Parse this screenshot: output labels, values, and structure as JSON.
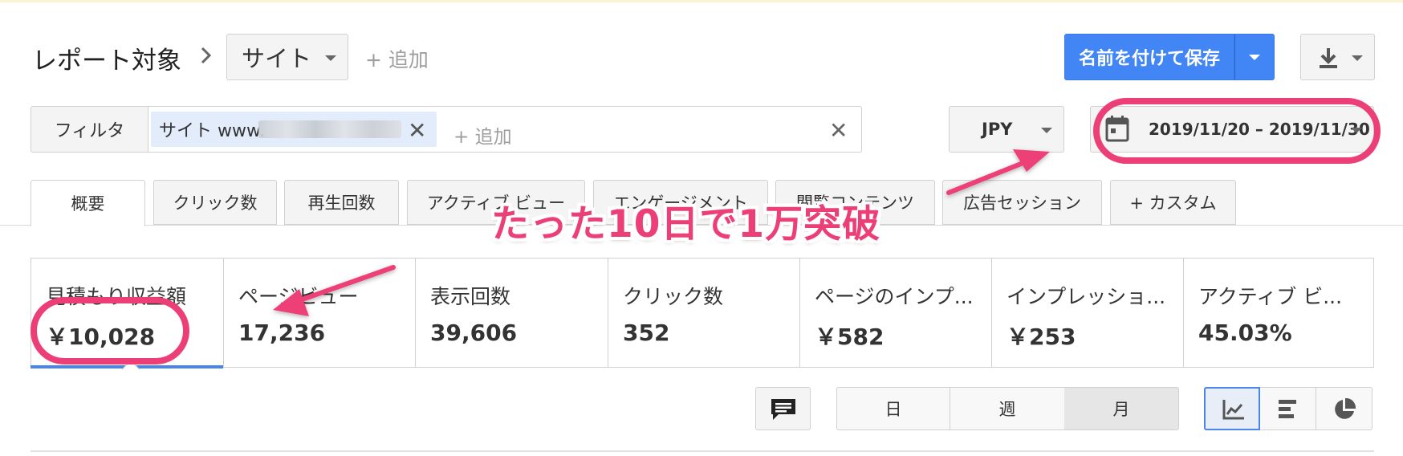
{
  "header": {
    "report_label": "レポート対象",
    "dimension_dropdown": "サイト",
    "add_label": "+ 追加",
    "save_button": "名前を付けて保存",
    "download_icon": "download-icon"
  },
  "filter": {
    "filter_button": "フィルタ",
    "chip_text": "サイト www.",
    "add_label": "+ 追加"
  },
  "currency": "JPY",
  "date_range": "2019/11/20 – 2019/11/30",
  "tabs": [
    {
      "label": "概要",
      "active": true
    },
    {
      "label": "クリック数"
    },
    {
      "label": "再生回数"
    },
    {
      "label": "アクティブ ビュー"
    },
    {
      "label": "エンゲージメント"
    },
    {
      "label": "閲覧コンテンツ"
    },
    {
      "label": "広告セッション"
    },
    {
      "label": "+ カスタム"
    }
  ],
  "metrics": [
    {
      "label": "見積もり収益額",
      "value": "￥10,028"
    },
    {
      "label": "ページビュー",
      "value": "17,236"
    },
    {
      "label": "表示回数",
      "value": "39,606"
    },
    {
      "label": "クリック数",
      "value": "352"
    },
    {
      "label": "ページのインプ...",
      "value": "￥582"
    },
    {
      "label": "インプレッショ...",
      "value": "￥253"
    },
    {
      "label": "アクティブ ビ...",
      "value": "45.03%"
    }
  ],
  "periods": [
    "日",
    "週",
    "月"
  ],
  "selected_period": "月",
  "chart_types": [
    "line-chart-icon",
    "bar-chart-icon",
    "pie-chart-icon"
  ],
  "annotation": "たった10日で1万突破",
  "colors": {
    "accent_blue": "#4285f4",
    "annotation_pink": "#ec3f77"
  }
}
